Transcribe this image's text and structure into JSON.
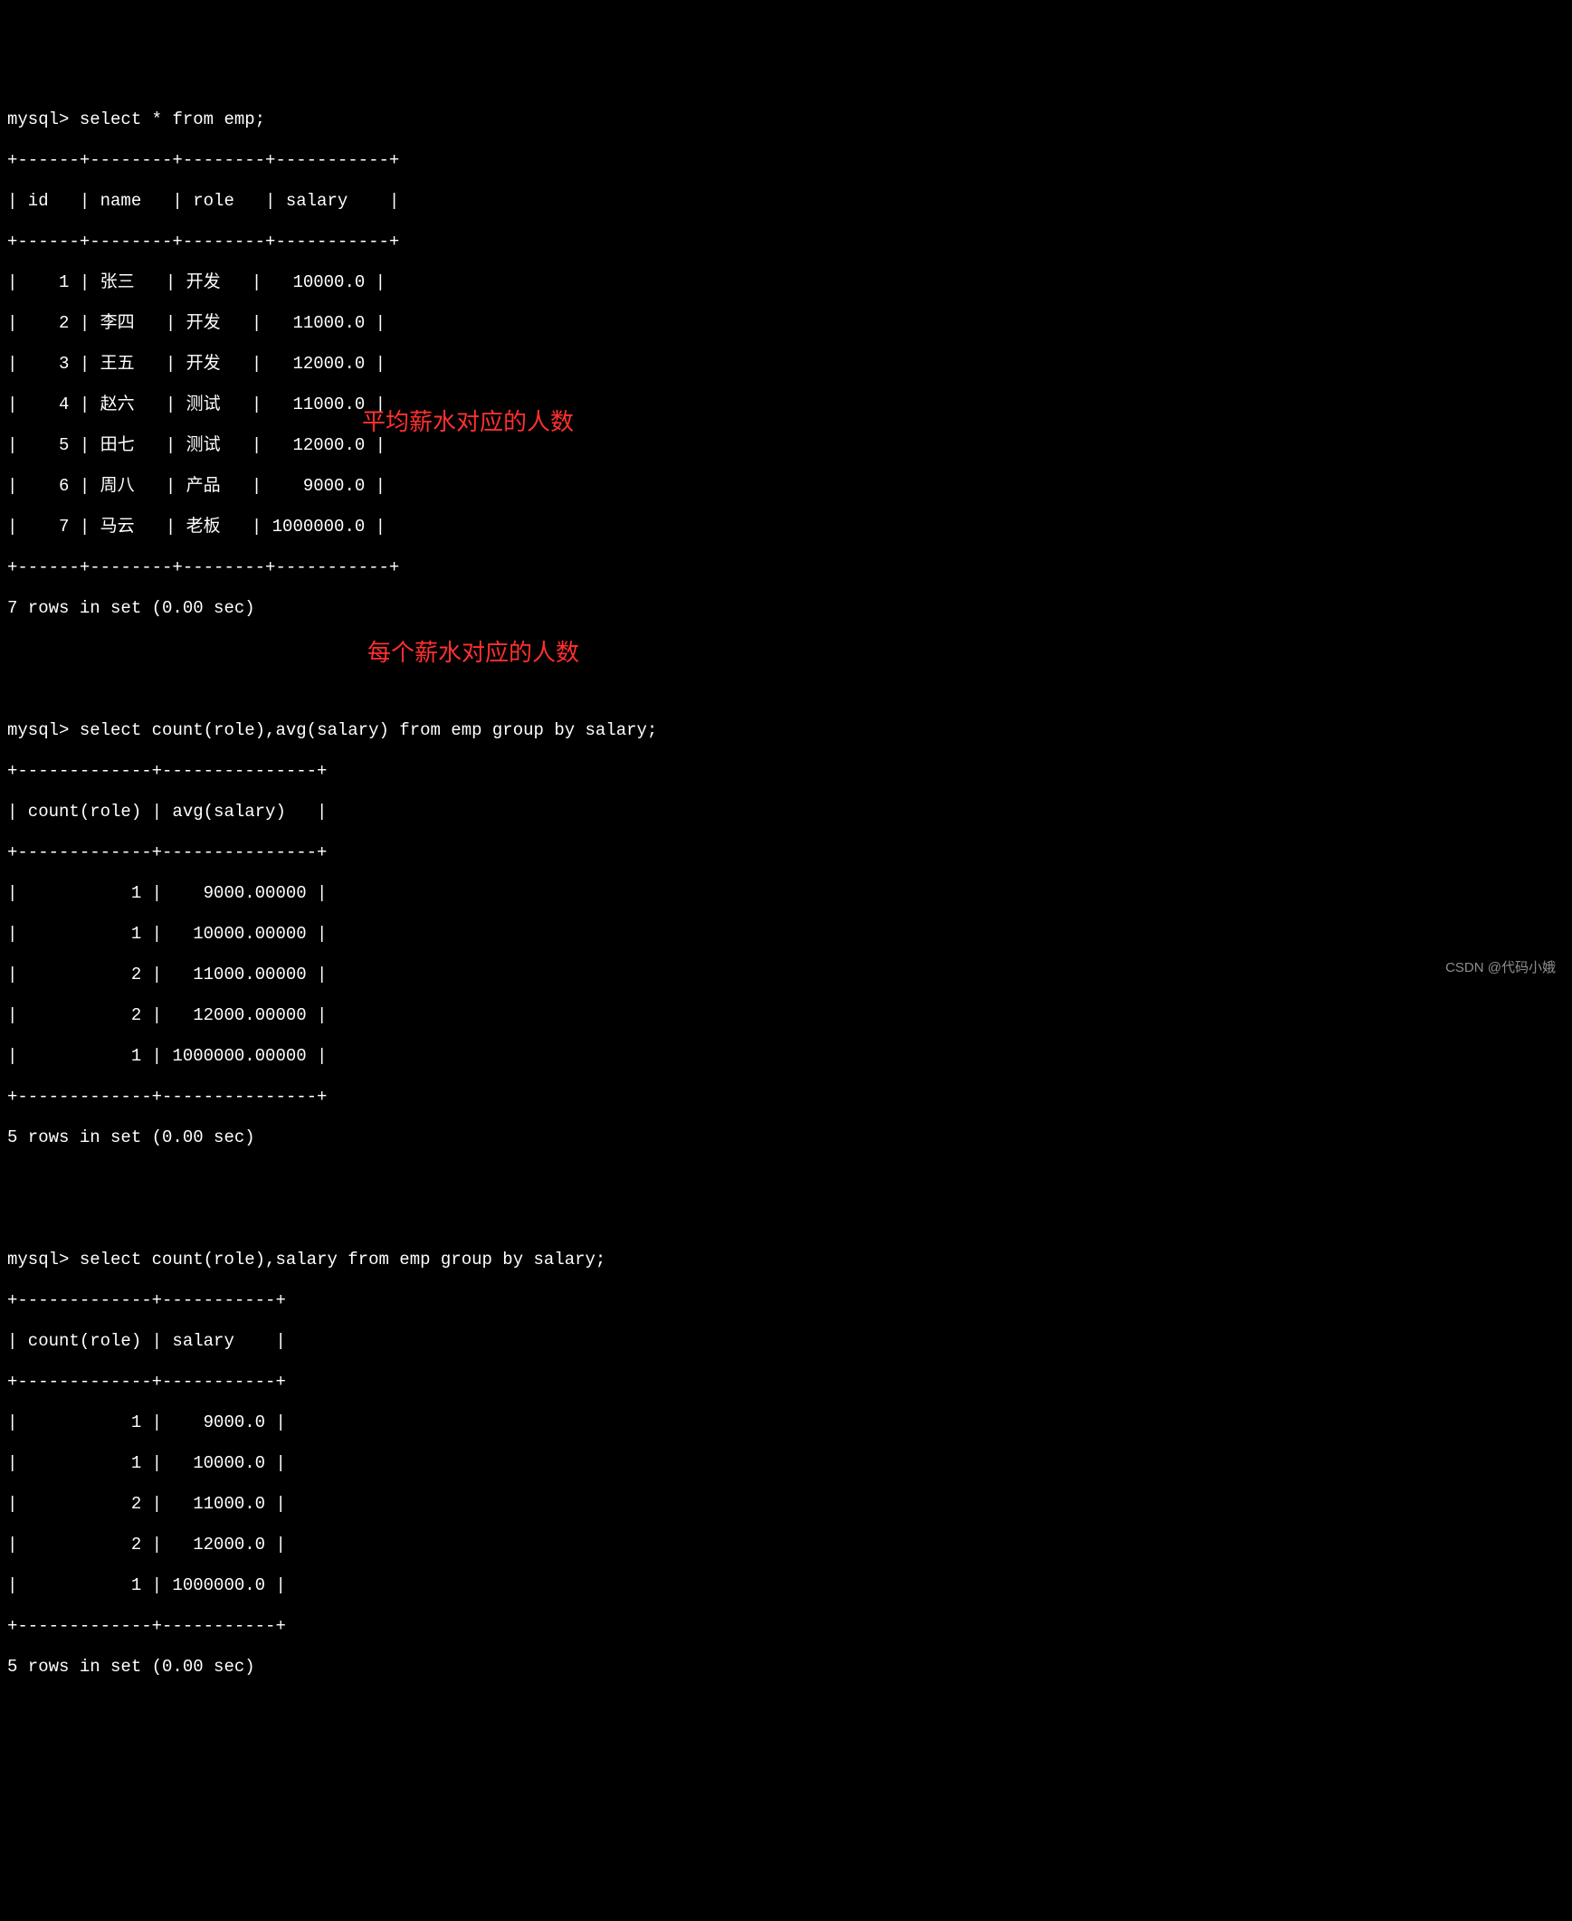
{
  "query1": {
    "prompt": "mysql> ",
    "sql": "select * from emp;",
    "border": "+------+--------+--------+-----------+",
    "header": "| id   | name   | role   | salary    |",
    "rows": [
      "|    1 | 张三   | 开发   |   10000.0 |",
      "|    2 | 李四   | 开发   |   11000.0 |",
      "|    3 | 王五   | 开发   |   12000.0 |",
      "|    4 | 赵六   | 测试   |   11000.0 |",
      "|    5 | 田七   | 测试   |   12000.0 |",
      "|    6 | 周八   | 产品   |    9000.0 |",
      "|    7 | 马云   | 老板   | 1000000.0 |"
    ],
    "footer": "7 rows in set (0.00 sec)"
  },
  "query2": {
    "prompt": "mysql> ",
    "sql": "select count(role),avg(salary) from emp group by salary;",
    "border": "+-------------+---------------+",
    "header": "| count(role) | avg(salary)   |",
    "rows": [
      "|           1 |    9000.00000 |",
      "|           1 |   10000.00000 |",
      "|           2 |   11000.00000 |",
      "|           2 |   12000.00000 |",
      "|           1 | 1000000.00000 |"
    ],
    "footer": "5 rows in set (0.00 sec)"
  },
  "query3": {
    "prompt": "mysql> ",
    "sql": "select count(role),salary from emp group by salary;",
    "border": "+-------------+-----------+",
    "header": "| count(role) | salary    |",
    "rows": [
      "|           1 |    9000.0 |",
      "|           1 |   10000.0 |",
      "|           2 |   11000.0 |",
      "|           2 |   12000.0 |",
      "|           1 | 1000000.0 |"
    ],
    "footer": "5 rows in set (0.00 sec)"
  },
  "annotations": {
    "note1": "平均薪水对应的人数",
    "note2": "每个薪水对应的人数"
  },
  "watermark": "CSDN @代码小娥"
}
